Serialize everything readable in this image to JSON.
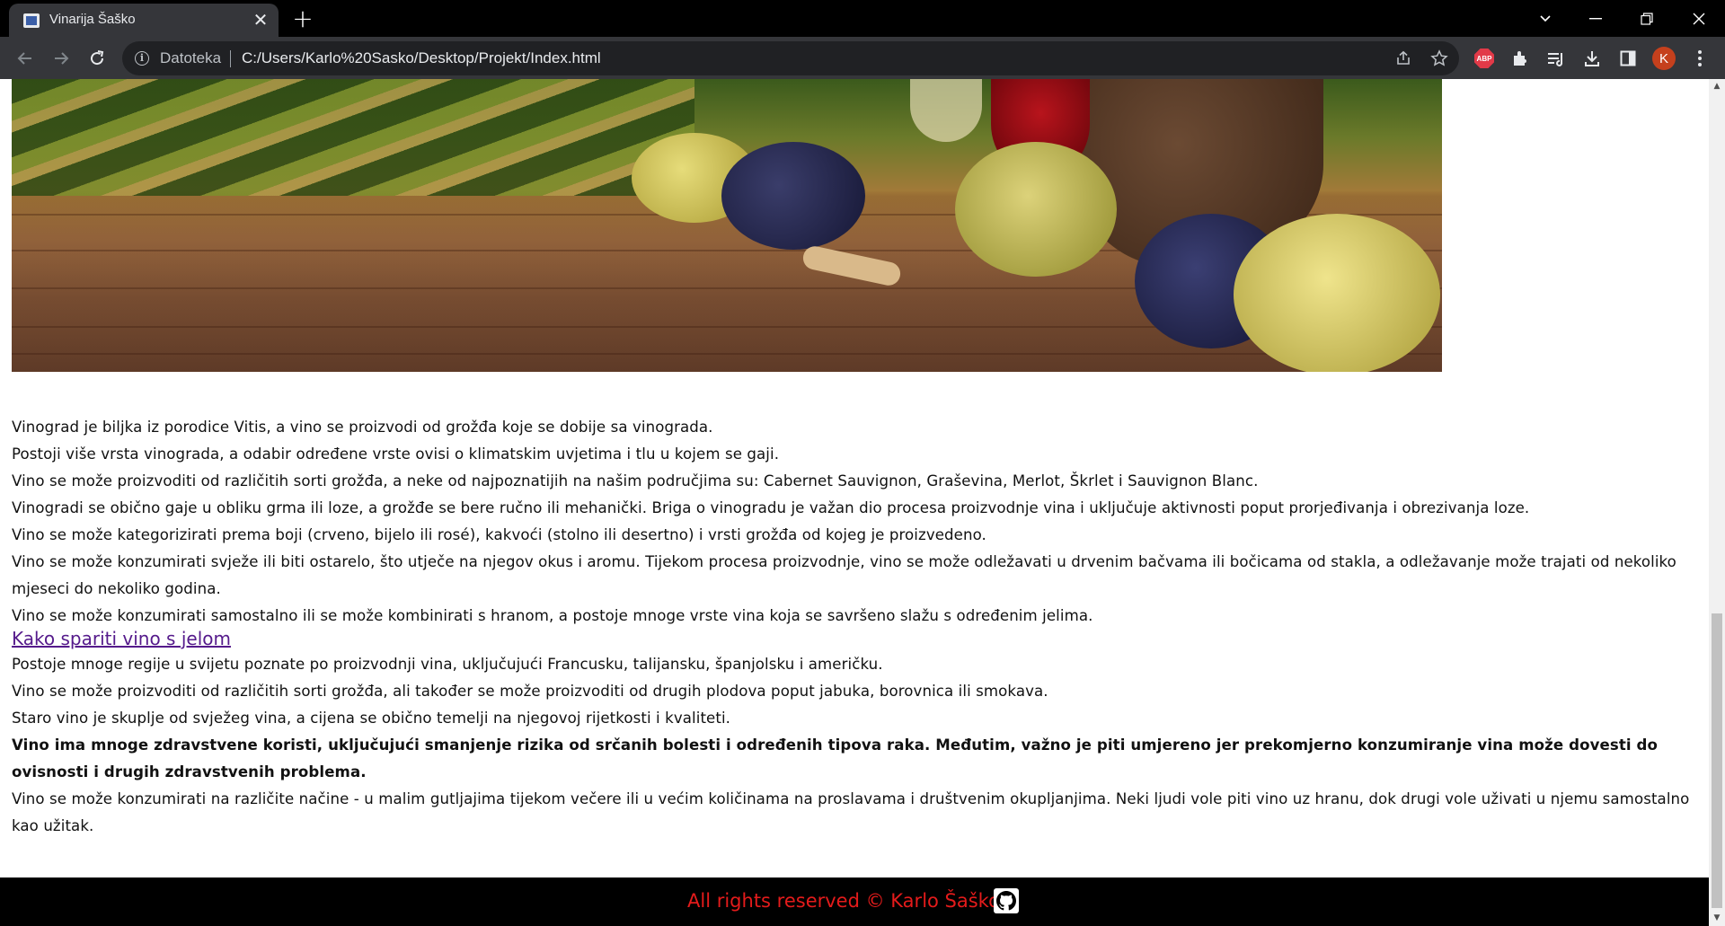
{
  "browser": {
    "tab_title": "Vinarija Šaško",
    "close_glyph": "✕",
    "new_tab_glyph": "+",
    "url_scheme_label": "Datoteka",
    "url": "C:/Users/Karlo%20Sasko/Desktop/Projekt/Index.html",
    "abp_label": "ABP",
    "profile_initial": "K"
  },
  "page": {
    "paragraphs_1": [
      "Vinograd je biljka iz porodice Vitis, a vino se proizvodi od grožđa koje se dobije sa vinograda.",
      "Postoji više vrsta vinograda, a odabir određene vrste ovisi o klimatskim uvjetima i tlu u kojem se gaji.",
      "Vino se može proizvoditi od različitih sorti grožđa, a neke od najpoznatijih na našim područjima su: Cabernet Sauvignon, Graševina, Merlot, Škrlet i Sauvignon Blanc.",
      "Vinogradi se obično gaje u obliku grma ili loze, a grožđe se bere ručno ili mehanički. Briga o vinogradu je važan dio procesa proizvodnje vina i uključuje aktivnosti poput prorjeđivanja i obrezivanja loze.",
      "Vino se može kategorizirati prema boji (crveno, bijelo ili rosé), kakvoći (stolno ili desertno) i vrsti grožđa od kojeg je proizvedeno.",
      "Vino se može konzumirati svježe ili biti ostarelo, što utječe na njegov okus i aromu. Tijekom procesa proizvodnje, vino se može odležavati u drvenim bačvama ili bočicama od stakla, a odležavanje može trajati od nekoliko mjeseci do nekoliko godina.",
      "Vino se može konzumirati samostalno ili se može kombinirati s hranom, a postoje mnoge vrste vina koja se savršeno slažu s određenim jelima."
    ],
    "link_label": "Kako spariti vino s jelom",
    "paragraphs_2": [
      "Postoje mnoge regije u svijetu poznate po proizvodnji vina, uključujući Francusku, talijansku, španjolsku i američku.",
      "Vino se može proizvoditi od različitih sorti grožđa, ali također se može proizvoditi od drugih plodova poput jabuka, borovnica ili smokava.",
      "Staro vino je skuplje od svježeg vina, a cijena se obično temelji na njegovoj rijetkosti i kvaliteti."
    ],
    "bold_paragraph": "Vino ima mnoge zdravstvene koristi, uključujući smanjenje rizika od srčanih bolesti i određenih tipova raka. Međutim, važno je piti umjereno jer prekomjerno konzumiranje vina može dovesti do ovisnosti i drugih zdravstvenih problema.",
    "last_paragraph": "Vino se može konzumirati na različite načine - u malim gutljajima tijekom večere ili u većim količinama na proslavama i društvenim okupljanjima. Neki ljudi vole piti vino uz hranu, dok drugi vole uživati u njemu samostalno kao užitak.",
    "footer_text": "All rights reserved © Karlo Šaško"
  },
  "colors": {
    "footer_text": "#e41b1b",
    "link": "#551a8b",
    "chrome_bg": "#35363a"
  },
  "icons": [
    "tab-favicon-icon",
    "close-icon",
    "new-tab-icon",
    "back-icon",
    "forward-icon",
    "reload-icon",
    "info-icon",
    "share-icon",
    "bookmark-star-icon",
    "abp-icon",
    "extensions-icon",
    "reading-list-icon",
    "download-icon",
    "side-panel-icon",
    "avatar",
    "menu-icon",
    "github-icon"
  ]
}
